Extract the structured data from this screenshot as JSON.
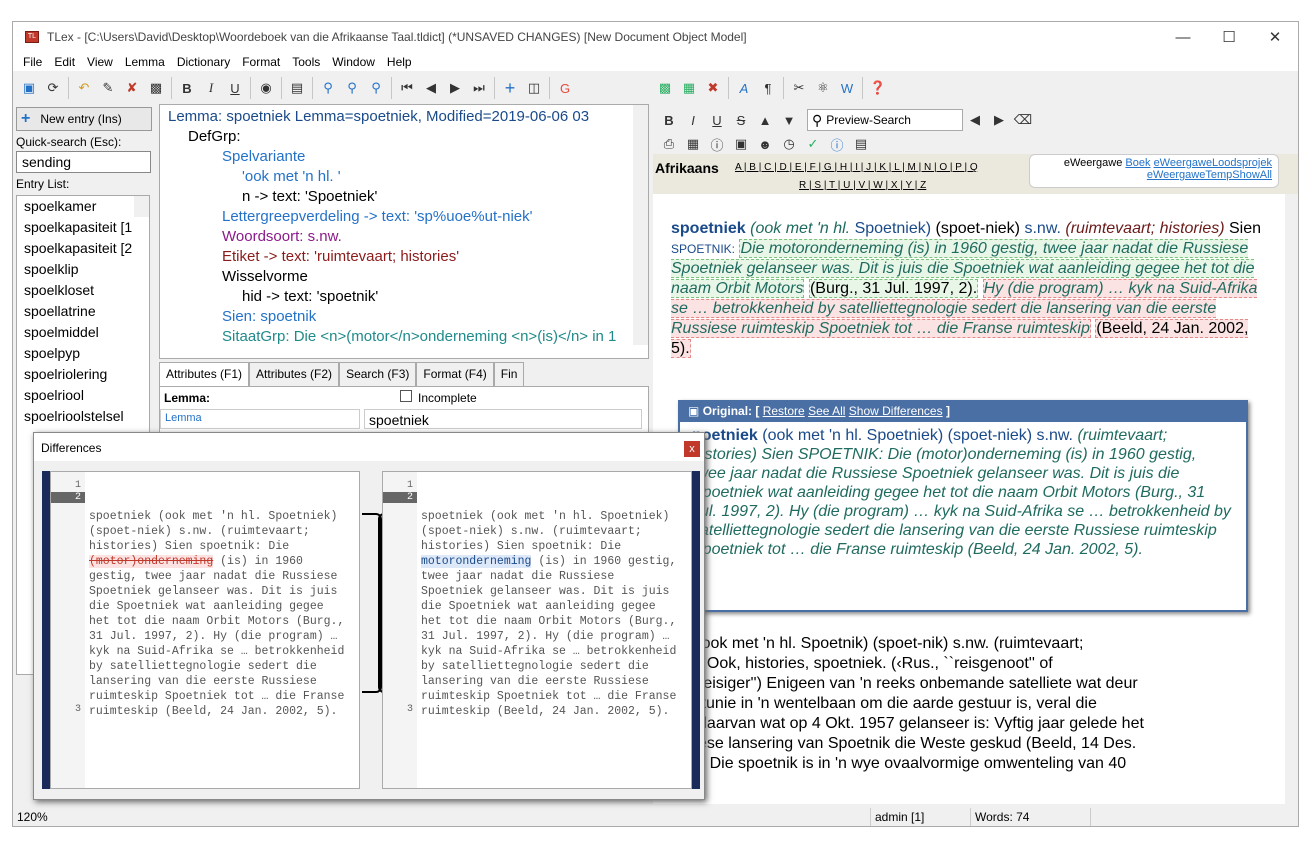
{
  "window": {
    "title": "TLex - [C:\\Users\\David\\Desktop\\Woordeboek van die Afrikaanse Taal.tldict] (*UNSAVED CHANGES) [New Document Object Model]"
  },
  "menu": [
    "File",
    "Edit",
    "View",
    "Lemma",
    "Dictionary",
    "Format",
    "Tools",
    "Window",
    "Help"
  ],
  "left": {
    "new_entry": "New entry (Ins)",
    "quick_search_label": "Quick-search (Esc):",
    "quick_search_value": "sending",
    "entry_list_label": "Entry List:",
    "entries": [
      "spoelkamer",
      "spoelkapasiteit [1",
      "spoelkapasiteit [2",
      "spoelklip",
      "spoelkloset",
      "spoellatrine",
      "spoelmiddel",
      "spoelpyp",
      "spoelriolering",
      "spoelriool",
      "spoelrioolstelsel"
    ]
  },
  "tree": {
    "lemma": "Lemma: spoetniek  Lemma=spoetniek, Modified=2019-06-06 03",
    "defgrp": "DefGrp:",
    "spelvariante": "Spelvariante",
    "ook": "'ook met 'n hl. '",
    "n_text": "n -> text: 'Spoetniek'",
    "lettergreep": "Lettergreepverdeling -> text: 'sp%uoe%ut-niek'",
    "woordsoort": "Woordsoort: s.nw.",
    "etiket": "Etiket -> text: 'ruimtevaart; histories'",
    "wisselvorme": "Wisselvorme",
    "hid": "hid -> text: 'spoetnik'",
    "sien": "Sien: spoetnik",
    "sitaat": "SitaatGrp: Die <n>(motor</n>onderneming <n>(is)</n> in 1"
  },
  "tabs": [
    "Attributes (F1)",
    "Attributes (F2)",
    "Search (F3)",
    "Format (F4)",
    "Fin"
  ],
  "attrs": {
    "lemma_label": "Lemma:",
    "incomplete": "Incomplete",
    "lemma_field": "Lemma",
    "lemma_value": "spoetniek"
  },
  "right": {
    "preview_search": "Preview-Search",
    "alpha_title": "Afrikaans",
    "alpha_row1": "A | B | C | D | E | F | G | H | I | J | K | L | M | N | O | P | Q",
    "alpha_row2": "R | S | T | U | V | W | X | Y | Z",
    "eweergawe": "eWeergawe",
    "link1": "Boek",
    "link2": "eWeergaweLoodsprojek",
    "link3": "eWeergaweTempShowAll"
  },
  "entry": {
    "head": "spoetniek",
    "p1": "(ook met 'n hl.",
    "p2": "Spoetniek)",
    "p3": "(spoet-niek)",
    "p4": "s.nw.",
    "p5": "(ruimtevaart; histories)",
    "p6": "Sien",
    "p7": "SPOETNIK:",
    "cit1": "Die motoronderneming (is) in 1960 gestig, twee jaar nadat die Russiese Spoetniek gelanseer was. Dit is juis die Spoetniek wat aanleiding gegee het tot die naam Orbit Motors",
    "src1": "(Burg., 31 Jul. 1997, 2).",
    "cit2": "Hy (die program) … kyk na Suid-Afrika se … betrokkenheid by satelliettegnologie sedert die lansering van die eerste Russiese ruimteskip Spoetniek tot … die Franse ruimteskip",
    "src2": "(Beeld, 24 Jan. 2002, 5)."
  },
  "popup": {
    "title": "Original:",
    "restore": "Restore",
    "seeall": "See All",
    "showdiff": "Show Differences",
    "text_head": "poetniek",
    "text1": "(ook met 'n hl. Spoetniek) (spoet-niek) s.nw.",
    "text2": "(ruimtevaart; histories) Sien SPOETNIK: Die (motor)onderneming (is) in 1960 gestig, twee jaar nadat die Russiese Spoetniek gelanseer was. Dit is juis die Spoetniek wat aanleiding gegee het tot die naam Orbit Motors (Burg., 31 Jul. 1997, 2). Hy (die program) … kyk na Suid-Afrika se … betrokkenheid by satelliettegnologie sedert die lansering van die eerste Russiese ruimteskip Spoetniek tot … die Franse ruimteskip (Beeld, 24 Jan. 2002, 5)."
  },
  "entry2": {
    "line1": "etnik (ook met 'n hl. Spoetnik) (spoet-nik) s.nw. (ruimtevaart;",
    "line2": "tories) Ook, histories, spoetniek. (‹Rus., ``reisgenoot'' of",
    "line3": "medereisiger'') Enigeen van 'n reeks onbemande satelliete wat deur",
    "line4": "Sowjetunie in 'n wentelbaan om die aarde gestuur is, veral die",
    "line5": "erste daarvan wat op 4 Okt. 1957 gelanseer is: Vyftig jaar gelede het",
    "line6": "Russiese lansering van Spoetnik die Weste geskud (Beeld, 14 Des.",
    "line7": "07, E). Die spoetnik is in 'n wye ovaalvormige omwenteling van 40"
  },
  "diff": {
    "title": "Differences",
    "close": "x",
    "left": {
      "l1": "spoetniek (ook met 'n hl. Spoetniek)",
      "l2": "(spoet-niek) s.nw. (ruimtevaart;",
      "l3": "histories) Sien spoetnik: Die",
      "l4_del": "(motor)onderneming",
      "l4_rest": " (is) in 1960",
      "l5": "gestig, twee jaar nadat die Russiese",
      "l6": "Spoetniek gelanseer was. Dit is juis",
      "l7": "die Spoetniek wat aanleiding gegee",
      "l8": "het tot die naam Orbit Motors (Burg.,",
      "l9": "31 Jul. 1997, 2). Hy (die program) …",
      "l10": "kyk na Suid-Afrika se … betrokkenheid",
      "l11": "by satelliettegnologie sedert die",
      "l12": "lansering van die eerste Russiese",
      "l13": "ruimteskip Spoetniek tot … die Franse",
      "l14": "ruimteskip (Beeld, 24 Jan. 2002, 5)."
    },
    "right": {
      "l1": "spoetniek (ook met 'n hl. Spoetniek)",
      "l2": "(spoet-niek) s.nw. (ruimtevaart;",
      "l3": "histories) Sien spoetnik: Die",
      "l4_ins": "motoronderneming",
      "l4_rest": " (is) in 1960 gestig,",
      "l5": "twee jaar nadat die Russiese",
      "l6": "Spoetniek gelanseer was. Dit is juis",
      "l7": "die Spoetniek wat aanleiding gegee",
      "l8": "het tot die naam Orbit Motors (Burg.,",
      "l9": "31 Jul. 1997, 2). Hy (die program) …",
      "l10": "kyk na Suid-Afrika se … betrokkenheid",
      "l11": "by satelliettegnologie sedert die",
      "l12": "lansering van die eerste Russiese",
      "l13": "ruimteskip Spoetniek tot … die Franse",
      "l14": "ruimteskip (Beeld, 24 Jan. 2002, 5)."
    },
    "ln1": "1",
    "ln2": "2",
    "ln3": "3"
  },
  "status": {
    "zoom": "120%",
    "user": "admin [1]",
    "words": "Words: 74"
  }
}
